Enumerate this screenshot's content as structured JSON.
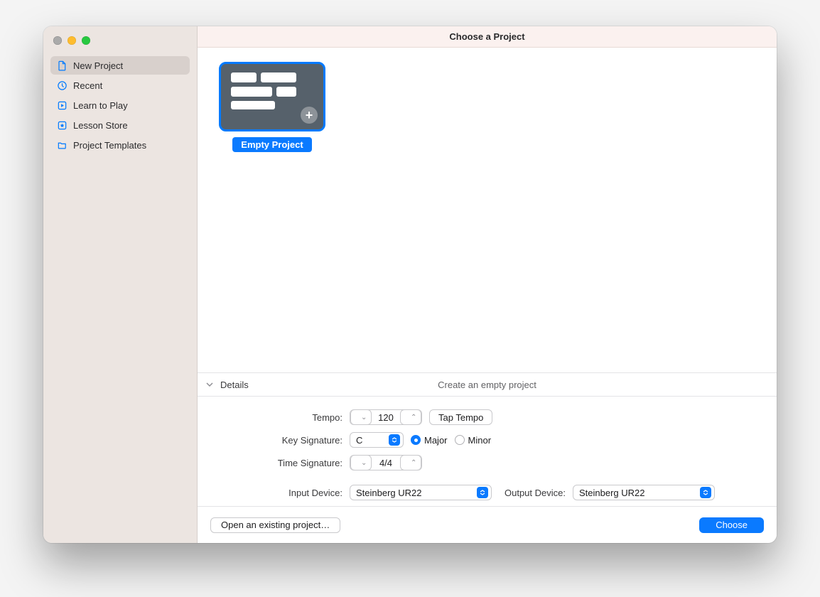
{
  "window": {
    "title": "Choose a Project"
  },
  "sidebar": {
    "items": [
      {
        "icon": "document-icon",
        "label": "New Project",
        "selected": true
      },
      {
        "icon": "clock-icon",
        "label": "Recent"
      },
      {
        "icon": "play-square-icon",
        "label": "Learn to Play"
      },
      {
        "icon": "star-square-icon",
        "label": "Lesson Store"
      },
      {
        "icon": "folder-icon",
        "label": "Project Templates"
      }
    ]
  },
  "templates": [
    {
      "name": "Empty Project",
      "selected": true
    }
  ],
  "details": {
    "header": "Details",
    "subtitle": "Create an empty project",
    "tempo_label": "Tempo:",
    "tempo_value": "120",
    "tap_tempo_label": "Tap Tempo",
    "key_label": "Key Signature:",
    "key_value": "C",
    "major_label": "Major",
    "minor_label": "Minor",
    "key_mode": "Major",
    "time_label": "Time Signature:",
    "time_value": "4/4",
    "input_label": "Input Device:",
    "input_value": "Steinberg UR22",
    "output_label": "Output Device:",
    "output_value": "Steinberg UR22"
  },
  "footer": {
    "open_existing": "Open an existing project…",
    "choose": "Choose"
  }
}
